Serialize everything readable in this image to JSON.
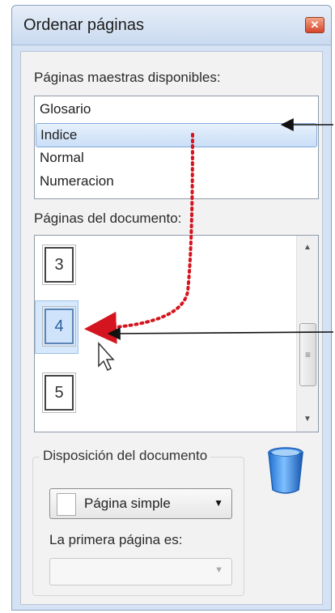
{
  "window": {
    "title": "Ordenar páginas"
  },
  "master_pages": {
    "label": "Páginas maestras disponibles:",
    "items": [
      "Glosario",
      "Indice",
      "Normal",
      "Numeracion"
    ],
    "selected_index": 1
  },
  "document_pages": {
    "label": "Páginas del documento:",
    "pages": [
      "3",
      "4",
      "5"
    ],
    "selected_index": 1
  },
  "layout": {
    "group_label": "Disposición del documento",
    "mode_value": "Página simple",
    "first_page_label": "La primera página es:",
    "first_page_value": ""
  },
  "colors": {
    "accent_arrow": "#d4141e",
    "selection": "#cfe3fa"
  }
}
